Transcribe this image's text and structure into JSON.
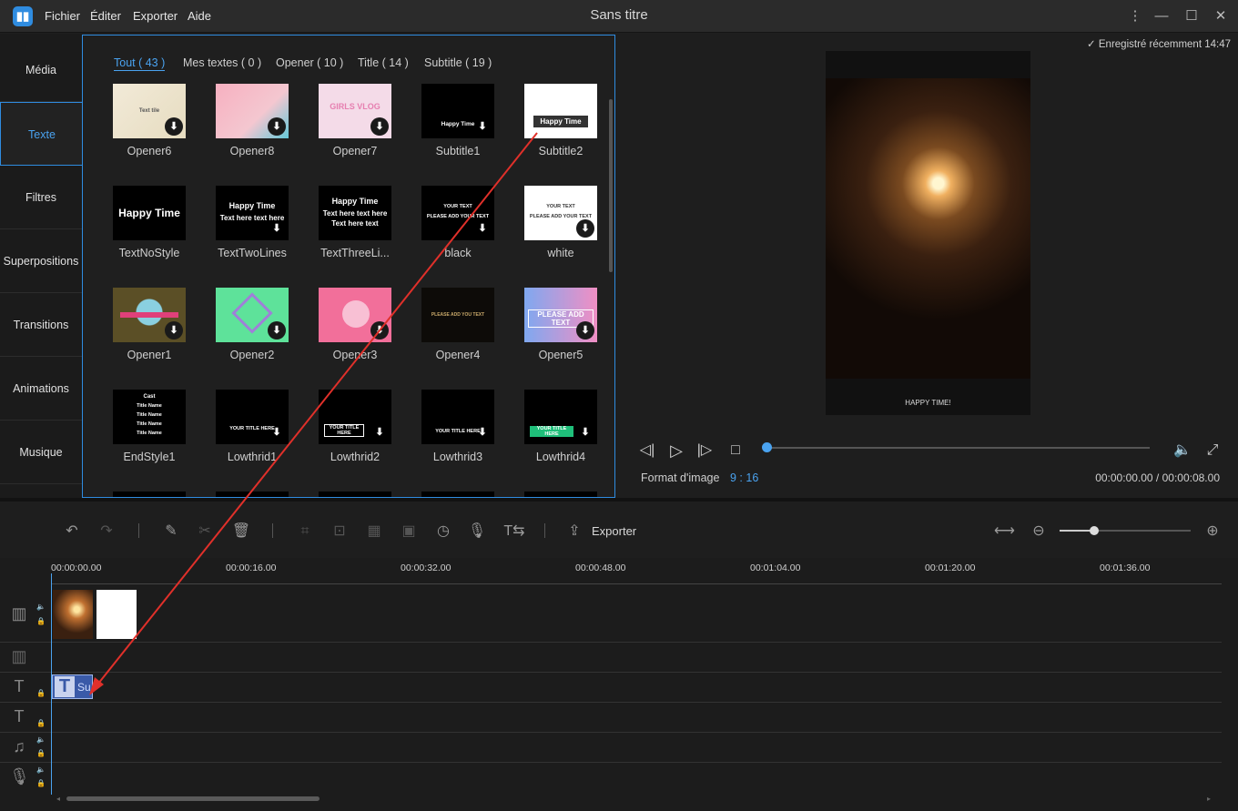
{
  "menu": {
    "items": [
      "Fichier",
      "Éditer",
      "Exporter",
      "Aide"
    ]
  },
  "window": {
    "title": "Sans titre"
  },
  "sidebar": {
    "items": [
      {
        "label": "Média",
        "active": false
      },
      {
        "label": "Texte",
        "active": true
      },
      {
        "label": "Filtres",
        "active": false
      },
      {
        "label": "Superpositions",
        "active": false
      },
      {
        "label": "Transitions",
        "active": false
      },
      {
        "label": "Animations",
        "active": false
      },
      {
        "label": "Musique",
        "active": false
      }
    ]
  },
  "library": {
    "tabs": [
      "Tout ( 43 )",
      "Mes textes ( 0 )",
      "Opener ( 10 )",
      "Title ( 14 )",
      "Subtitle ( 19 )"
    ],
    "active_tab": 0,
    "items": [
      "Opener6",
      "Opener8",
      "Opener7",
      "Subtitle1",
      "Subtitle2",
      "TextNoStyle",
      "TextTwoLines",
      "TextThreeLi...",
      "black",
      "white",
      "Opener1",
      "Opener2",
      "Opener3",
      "Opener4",
      "Opener5",
      "EndStyle1",
      "Lowthrid1",
      "Lowthrid2",
      "Lowthrid3",
      "Lowthrid4"
    ],
    "thumb_text": {
      "opener6": "Text tile",
      "subtitle1": "Happy Time",
      "subtitle2": "Happy Time",
      "textnostyle": "Happy Time",
      "texttwolines_1": "Happy Time",
      "texttwolines_2": "Text here text here",
      "textthree_1": "Happy Time",
      "textthree_2": "Text here text here",
      "textthree_3": "Text here text",
      "black_1": "YOUR TEXT",
      "black_2": "PLEASE ADD YOUR TEXT",
      "white_1": "YOUR TEXT",
      "white_2": "PLEASE ADD YOUR TEXT",
      "opener7": "GIRLS VLOG",
      "opener4": "PLEASE ADD YOU TEXT",
      "opener5": "PLEASE ADD TEXT",
      "endstyle_1": "Cast",
      "endstyle_2": "Title Name",
      "lowthrid1": "YOUR TITLE HERE",
      "lowthrid2": "YOUR TITLE HERE",
      "lowthrid3": "YOUR TITLE HERE",
      "lowthrid4": "YOUR TITLE HERE"
    }
  },
  "preview": {
    "saved_status": "Enregistré récemment 14:47",
    "caption": "HAPPY TIME!",
    "aspect_label": "Format d'image",
    "aspect_value": "9 : 16",
    "time": "00:00:00.00 / 00:00:08.00",
    "progress": 0.0
  },
  "toolbar": {
    "export_label": "Exporter",
    "zoom_level": 0.26
  },
  "timeline": {
    "ticks": [
      "00:00:00.00",
      "00:00:16.00",
      "00:00:32.00",
      "00:00:48.00",
      "00:01:04.00",
      "00:01:20.00",
      "00:01:36.00"
    ],
    "text_clip_label": "Su"
  },
  "colors": {
    "accent": "#2f8ce0",
    "annotation": "#e0302a"
  }
}
